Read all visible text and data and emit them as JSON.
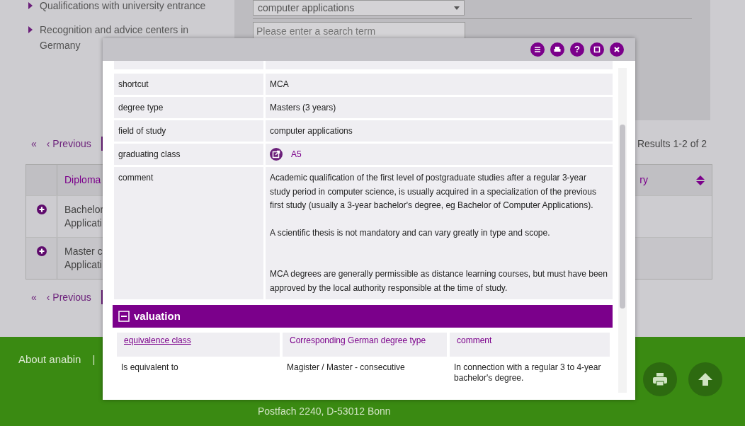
{
  "sidebar": {
    "items": [
      {
        "label": "Qualifications with university entrance"
      },
      {
        "label": "Recognition and advice centers in Germany"
      }
    ]
  },
  "search_panel": {
    "select_value": "computer applications",
    "search": {
      "placeholder": "Please enter a search term"
    }
  },
  "pagination": [
    {
      "first": "«",
      "previous": "‹ Previous"
    },
    {
      "first": "«",
      "previous": "‹ Previous"
    }
  ],
  "results": "Results 1-2 of 2",
  "table": {
    "columns": [
      {
        "label": "Diploma"
      },
      {
        "label": "ry"
      }
    ],
    "rows": [
      {
        "lines": [
          "Bachelor",
          "Applicati"
        ]
      },
      {
        "lines": [
          "Master c",
          "Applicati"
        ]
      }
    ]
  },
  "dialog": {
    "toolbar": [
      {
        "kind": "collapse"
      },
      {
        "kind": "print"
      },
      {
        "kind": "help",
        "label": "?"
      },
      {
        "kind": "maximize"
      },
      {
        "kind": "close"
      }
    ],
    "details": [
      {
        "label": "shortcut",
        "kind": "text",
        "value": "MCA"
      },
      {
        "label": "degree type",
        "kind": "text",
        "value": "Masters (3 years)"
      },
      {
        "label": "field of study",
        "kind": "text",
        "value": "computer applications"
      },
      {
        "label": "graduating class",
        "kind": "link",
        "value": "A5"
      },
      {
        "label": "comment",
        "kind": "paragraphs",
        "paragraphs": [
          "Academic qualification of the first level of postgraduate studies after a regular 3-year study period in computer science, is usually acquired in a specialization of the previous first study (usually a 3-year bachelor's degree, eg Bachelor of Computer Applications).",
          "A scientific thesis is not mandatory and can vary greatly in type and scope.",
          "MCA degrees are generally permissible as distance learning courses, but must have been approved by the local authority responsible at the time of study."
        ]
      }
    ],
    "valuation": {
      "title": "valuation",
      "expanded": true,
      "columns": [
        {
          "label": "equivalence class",
          "sorted": true
        },
        {
          "label": "Corresponding German degree type",
          "sorted": false
        },
        {
          "label": "comment",
          "sorted": false
        }
      ],
      "rows": [
        {
          "cells": [
            [
              "Is equivalent to"
            ],
            [
              "Magister / Master - consecutive"
            ],
            [
              "In connection with a regular 3 to 4-year bachelor's degree."
            ]
          ]
        }
      ]
    }
  },
  "footer": {
    "links": [
      "About anabin"
    ],
    "separator": "|",
    "address": [
      "Postfach 2240, D-53012 Bonn"
    ]
  }
}
